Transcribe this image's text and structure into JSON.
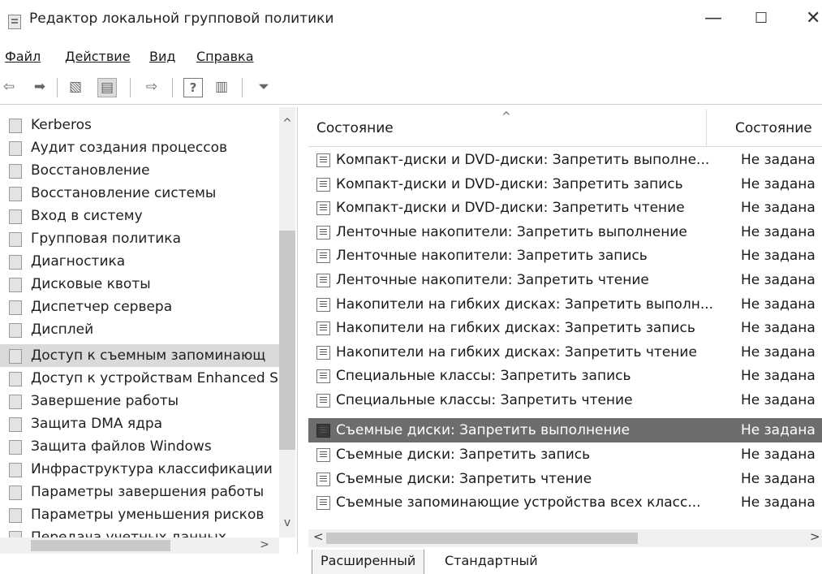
{
  "window": {
    "title": "Редактор локальной групповой политики",
    "controls": {
      "minimize": "—",
      "maximize": "☐",
      "close": "✕"
    }
  },
  "menu": [
    {
      "label": "Файл"
    },
    {
      "label": "Действие"
    },
    {
      "label": "Вид"
    },
    {
      "label": "Справка"
    }
  ],
  "toolbar": {
    "icons": [
      "back-icon",
      "forward-icon",
      "up-folder-icon",
      "show-hide-tree-icon",
      "export-list-icon",
      "help-icon",
      "properties-icon",
      "filter-icon"
    ]
  },
  "tree": {
    "selected_index": 10,
    "items": [
      "Kerberos",
      "Аудит создания процессов",
      "Восстановление",
      "Восстановление системы",
      "Вход в систему",
      "Групповая политика",
      "Диагностика",
      "Дисковые квоты",
      "Диспетчер сервера",
      "Дисплей",
      "Доступ к съемным запоминающ",
      "Доступ к устройствам Enhanced S",
      "Завершение работы",
      "Защита DMA ядра",
      "Защита файлов Windows",
      "Инфраструктура классификации",
      "Параметры завершения работы",
      "Параметры уменьшения рисков",
      "Передача учетных данных"
    ],
    "scroll_up": "^",
    "scroll_down": "v",
    "scroll_right": ">"
  },
  "list": {
    "columns": {
      "setting": "Состояние",
      "state": "Состояние"
    },
    "sort_indicator": "^",
    "selected_index": 11,
    "rows": [
      {
        "name": "Компакт-диски и DVD-диски: Запретить выполне...",
        "state": "Не задана"
      },
      {
        "name": "Компакт-диски и DVD-диски: Запретить запись",
        "state": "Не задана"
      },
      {
        "name": "Компакт-диски и DVD-диски: Запретить чтение",
        "state": "Не задана"
      },
      {
        "name": "Ленточные накопители: Запретить выполнение",
        "state": "Не задана"
      },
      {
        "name": "Ленточные накопители: Запретить запись",
        "state": "Не задана"
      },
      {
        "name": "Ленточные накопители: Запретить чтение",
        "state": "Не задана"
      },
      {
        "name": "Накопители на гибких дисках: Запретить выполн...",
        "state": "Не задана"
      },
      {
        "name": "Накопители на гибких дисках: Запретить запись",
        "state": "Не задана"
      },
      {
        "name": "Накопители на гибких дисках: Запретить чтение",
        "state": "Не задана"
      },
      {
        "name": "Специальные классы: Запретить запись",
        "state": "Не задана"
      },
      {
        "name": "Специальные классы: Запретить чтение",
        "state": "Не задана"
      },
      {
        "name": "Съемные диски: Запретить выполнение",
        "state": "Не задана"
      },
      {
        "name": "Съемные диски: Запретить запись",
        "state": "Не задана"
      },
      {
        "name": "Съемные диски: Запретить чтение",
        "state": "Не задана"
      },
      {
        "name": "Съемные запоминающие устройства всех класс...",
        "state": "Не задана"
      }
    ],
    "scroll_left": "<",
    "scroll_right": ">"
  },
  "tabs": [
    {
      "label": "Расширенный"
    },
    {
      "label": "Стандартный",
      "active": true
    }
  ]
}
